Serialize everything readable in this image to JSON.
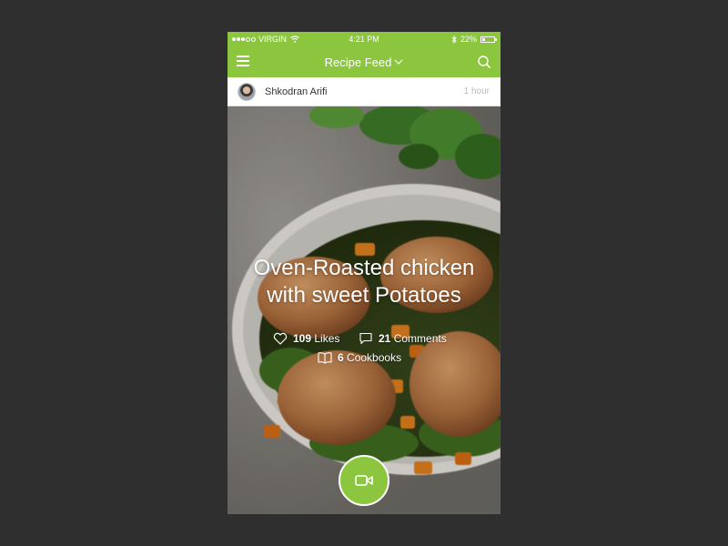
{
  "status_bar": {
    "carrier": "VIRGIN",
    "time": "4:21 PM",
    "battery": "22%",
    "battery_level": 0.22
  },
  "nav": {
    "title": "Recipe Feed",
    "menu_icon": "hamburger-icon",
    "search_icon": "search-icon"
  },
  "post": {
    "author": "Shkodran Arifi",
    "time_ago": "1 hour",
    "title_line1": "Oven-Roasted chicken",
    "title_line2": "with sweet Potatoes",
    "likes_count": "109",
    "likes_label": "Likes",
    "comments_count": "21",
    "comments_label": "Comments",
    "cookbooks_count": "6",
    "cookbooks_label": "Cookbooks"
  },
  "colors": {
    "accent": "#8cc63f",
    "background": "#2f2f2f"
  }
}
